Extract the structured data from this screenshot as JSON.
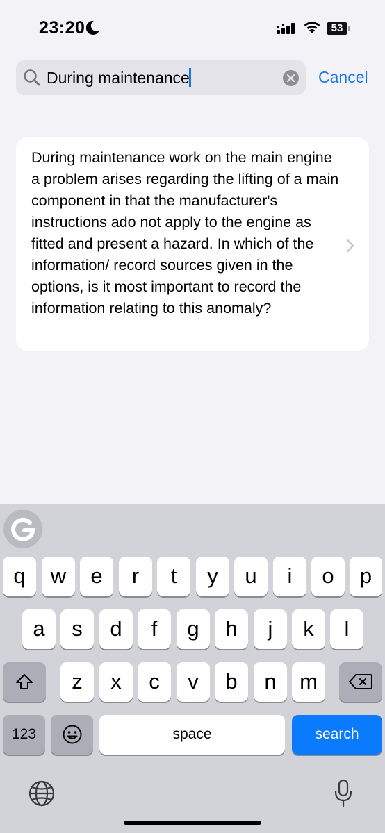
{
  "status_bar": {
    "time": "23:20",
    "battery": "53"
  },
  "search": {
    "query": "During maintenance",
    "cancel_label": "Cancel"
  },
  "results": [
    {
      "text": "During maintenance work on the main engine a problem arises regarding the lifting of a main component in that the manufacturer's instructions ado not apply to the engine as fitted and present a hazard. In which of the information/ record sources given in the options, is it most important to record the information relating to this anomaly?"
    }
  ],
  "keyboard": {
    "row1": [
      "q",
      "w",
      "e",
      "r",
      "t",
      "y",
      "u",
      "i",
      "o",
      "p"
    ],
    "row2": [
      "a",
      "s",
      "d",
      "f",
      "g",
      "h",
      "j",
      "k",
      "l"
    ],
    "row3": [
      "z",
      "x",
      "c",
      "v",
      "b",
      "n",
      "m"
    ],
    "numbers_label": "123",
    "space_label": "space",
    "search_label": "search"
  },
  "colors": {
    "accent": "#1a78e6",
    "search_key": "#0a7aff",
    "background": "#f2f2f7",
    "keyboard_bg": "#d1d3d9"
  },
  "icons": [
    "moon-icon",
    "signal-icon",
    "wifi-icon",
    "battery-icon",
    "search-icon",
    "clear-icon",
    "chevron-right-icon",
    "grammarly-icon",
    "shift-icon",
    "delete-icon",
    "emoji-icon",
    "globe-icon",
    "microphone-icon"
  ]
}
